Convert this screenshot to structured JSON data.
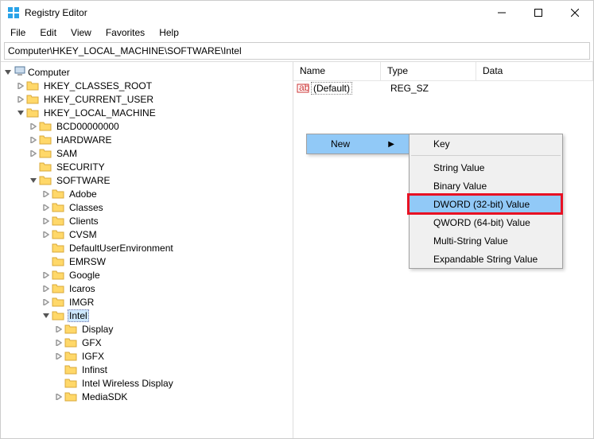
{
  "title": "Registry Editor",
  "window_controls": {
    "min": "minimize",
    "max": "maximize",
    "close": "close"
  },
  "menu": [
    "File",
    "Edit",
    "View",
    "Favorites",
    "Help"
  ],
  "path": "Computer\\HKEY_LOCAL_MACHINE\\SOFTWARE\\Intel",
  "tree": {
    "root": "Computer",
    "hives": [
      "HKEY_CLASSES_ROOT",
      "HKEY_CURRENT_USER",
      "HKEY_LOCAL_MACHINE"
    ],
    "hklm": [
      "BCD00000000",
      "HARDWARE",
      "SAM",
      "SECURITY",
      "SOFTWARE"
    ],
    "software": [
      "Adobe",
      "Classes",
      "Clients",
      "CVSM",
      "DefaultUserEnvironment",
      "EMRSW",
      "Google",
      "Icaros",
      "IMGR",
      "Intel"
    ],
    "intel": [
      "Display",
      "GFX",
      "IGFX",
      "Infinst",
      "Intel Wireless Display",
      "MediaSDK"
    ]
  },
  "list": {
    "headers": [
      "Name",
      "Type",
      "Data"
    ],
    "row": {
      "name": "(Default)",
      "type": "REG_SZ",
      "data": ""
    }
  },
  "context": {
    "new": "New",
    "items": [
      "Key",
      "String Value",
      "Binary Value",
      "DWORD (32-bit) Value",
      "QWORD (64-bit) Value",
      "Multi-String Value",
      "Expandable String Value"
    ]
  }
}
